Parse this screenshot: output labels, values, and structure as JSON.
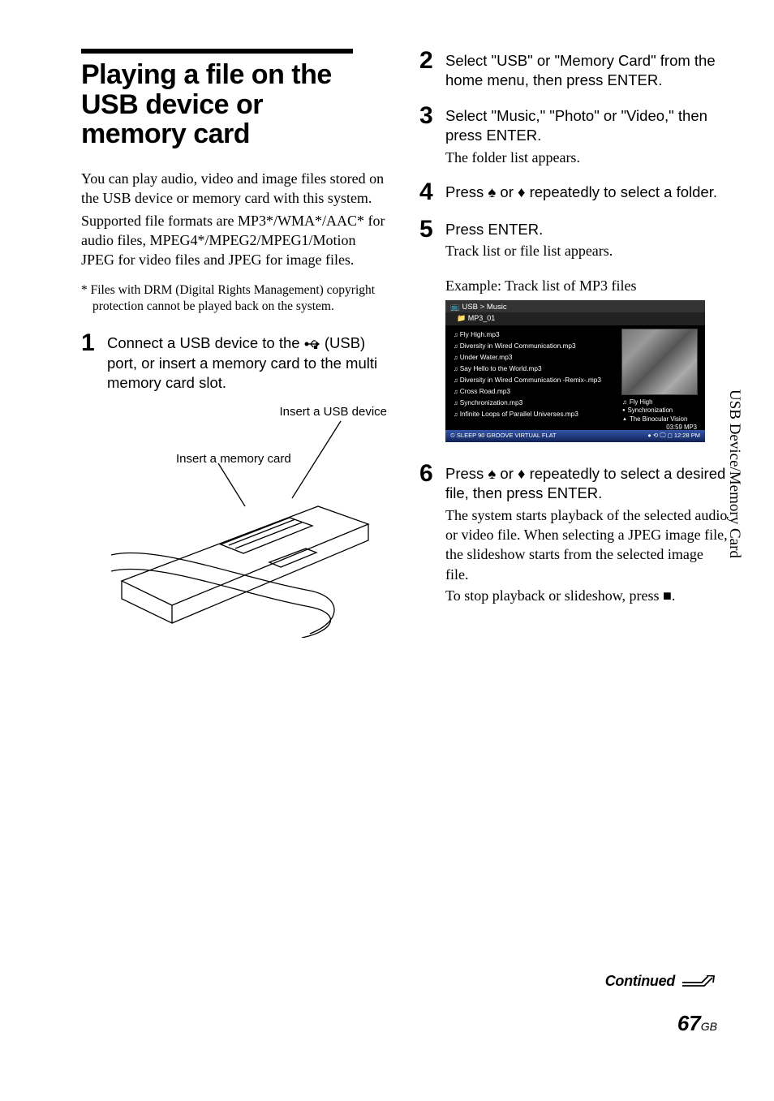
{
  "title": "Playing a file on the USB device or memory card",
  "intro1": "You can play audio, video and image files stored on the USB device or memory card with this system.",
  "intro2": "Supported file formats are MP3*/WMA*/AAC* for audio files, MPEG4*/MPEG2/MPEG1/Motion JPEG for video files and JPEG for image files.",
  "footnote_mark": "*",
  "footnote": "Files with DRM (Digital Rights Management) copyright protection cannot be played back on the system.",
  "steps": {
    "s1": {
      "num": "1",
      "main_a": "Connect a USB device to the ",
      "main_b": " (USB) port, or insert a memory card to the multi memory card slot.",
      "label_usb": "Insert a USB device",
      "label_card": "Insert a memory card"
    },
    "s2": {
      "num": "2",
      "main": "Select \"USB\" or \"Memory Card\" from the home menu, then press ENTER."
    },
    "s3": {
      "num": "3",
      "main": "Select \"Music,\" \"Photo\" or \"Video,\" then press ENTER.",
      "sub": "The folder list appears."
    },
    "s4": {
      "num": "4",
      "main_a": "Press ",
      "main_b": " or ",
      "main_c": " repeatedly to select a folder."
    },
    "s5": {
      "num": "5",
      "main": "Press ENTER.",
      "sub": "Track list or file list appears.",
      "caption": "Example: Track list of MP3 files"
    },
    "s6": {
      "num": "6",
      "main_a": "Press ",
      "main_b": " or ",
      "main_c": " repeatedly to select a desired file, then press ENTER.",
      "sub1": "The system starts playback of the selected audio or video file. When selecting a JPEG image file, the slideshow starts from the selected image file.",
      "sub2a": "To stop playback or slideshow, press ",
      "sub2b": "."
    }
  },
  "track_screen": {
    "breadcrumb": "USB > Music",
    "folder": "MP3_01",
    "items": [
      "Fly High.mp3",
      "Diversity in Wired Communication.mp3",
      "Under Water.mp3",
      "Say Hello to the World.mp3",
      "Diversity in Wired Communication -Remix-.mp3",
      "Cross Road.mp3",
      "Synchronization.mp3",
      "Infinite Loops of Parallel Universes.mp3"
    ],
    "meta": {
      "title": "Fly High",
      "album": "Synchronization",
      "artist": "The Binocular Vision",
      "time": "03:59   MP3"
    },
    "footer_left": "⏲ SLEEP 90   GROOVE   VIRTUAL   FLAT",
    "footer_right": "● ⟲ 🖵 ◻ 12:28 PM"
  },
  "side_tab": "USB Device/Memory Card",
  "continued": "Continued",
  "page_num": "67",
  "page_region": "GB"
}
